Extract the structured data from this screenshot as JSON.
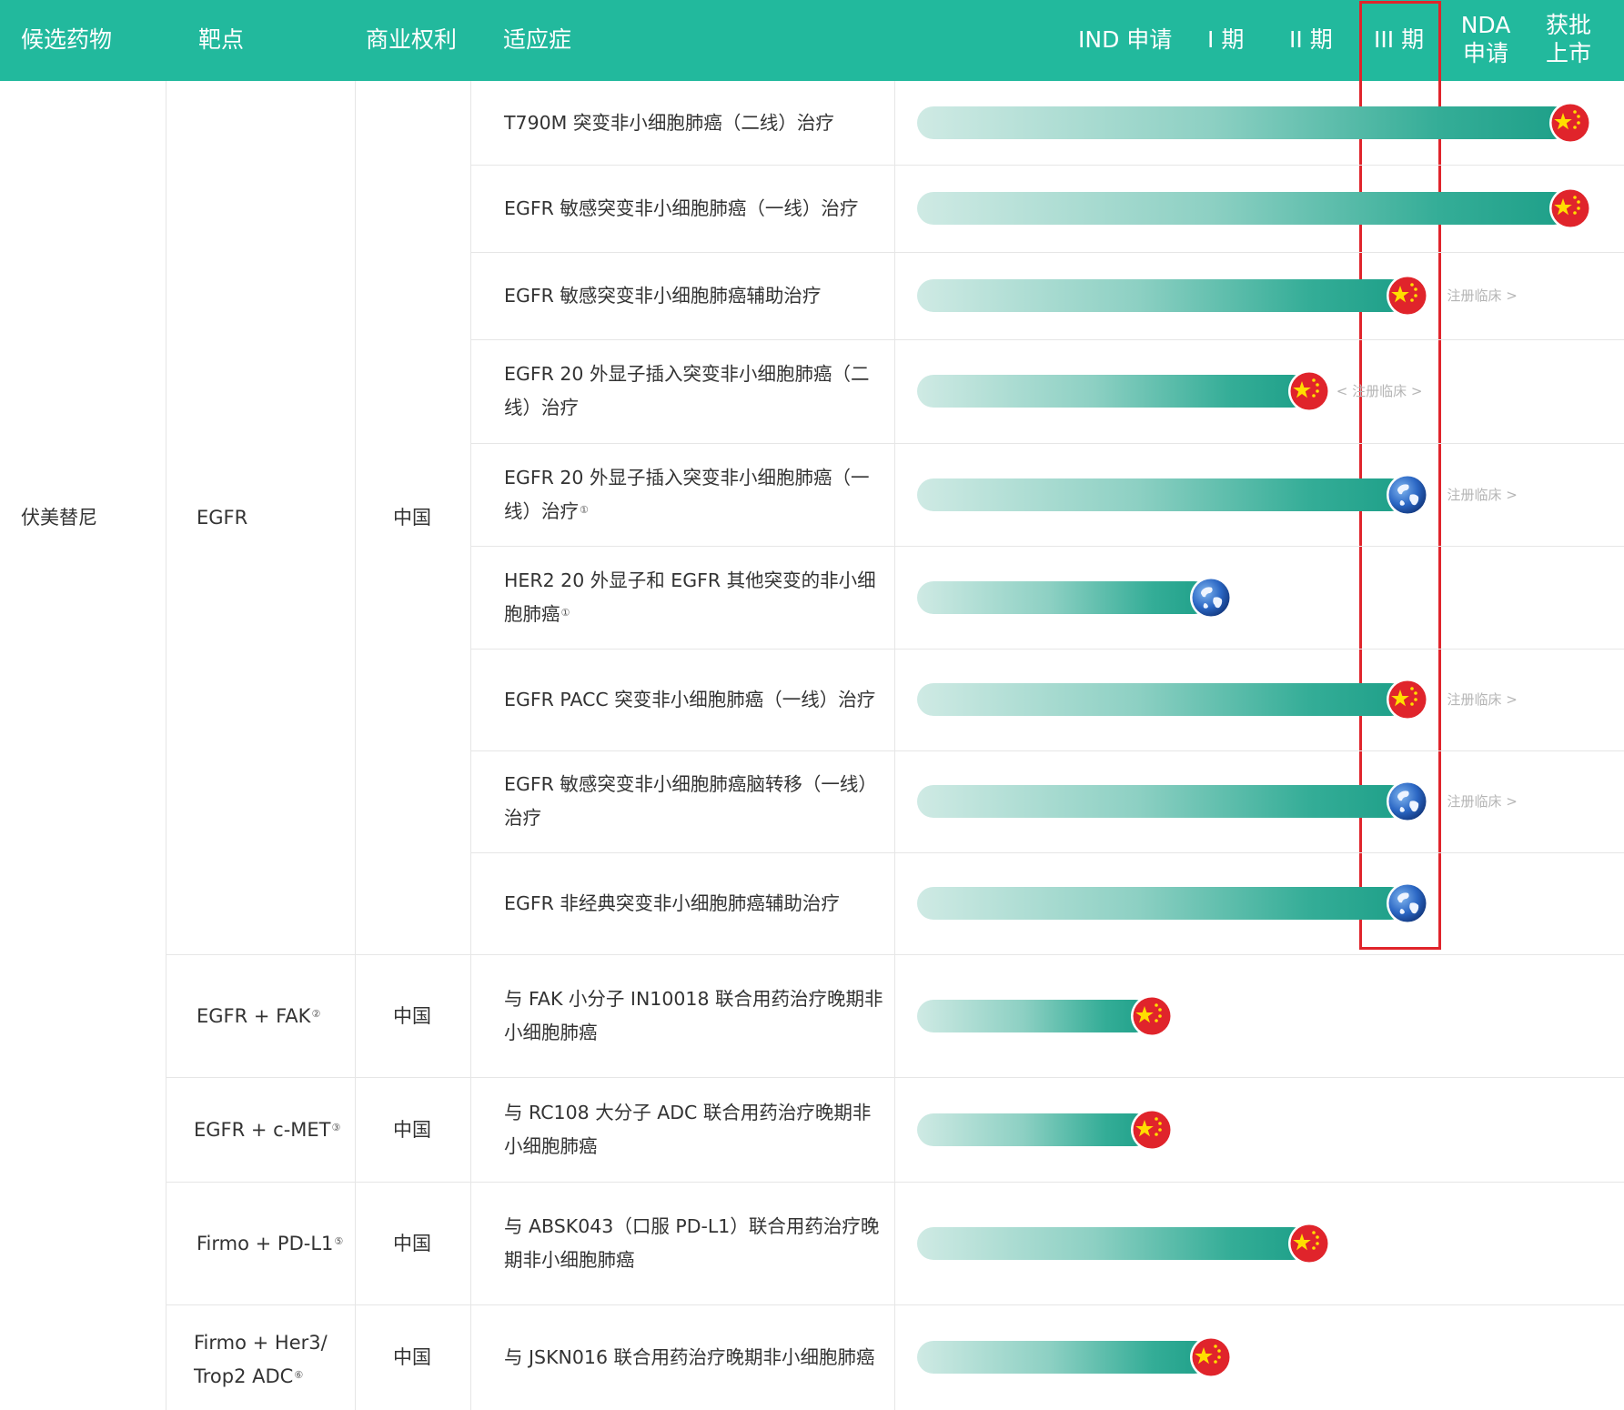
{
  "header": {
    "candidate": "候选药物",
    "target": "靶点",
    "rights": "商业权利",
    "indication": "适应症",
    "stage_ind": "IND 申请",
    "stage_p1": "I 期",
    "stage_p2": "II 期",
    "stage_p3": "III 期",
    "stage_nda_line1": "NDA",
    "stage_nda_line2": "申请",
    "stage_approved_line1": "获批",
    "stage_approved_line2": "上市"
  },
  "colors": {
    "header_bg": "#22b99d",
    "bar_end": "#1d9f88",
    "highlight": "#e0242b"
  },
  "candidate": "伏美替尼",
  "register_label": "注册临床 >",
  "register_label_left": "< 注册临床 >",
  "groups": [
    {
      "target": "EGFR",
      "target_note": "",
      "rights": "中国"
    },
    {
      "target": "EGFR + FAK",
      "target_note": "②",
      "rights": "中国"
    },
    {
      "target": "EGFR + c-MET",
      "target_note": "③",
      "rights": "中国"
    },
    {
      "target": "Firmo + PD-L1",
      "target_note": "⑤",
      "rights": "中国"
    },
    {
      "target_line1": "Firmo + Her3/",
      "target_line2": "Trop2 ADC",
      "target_note": "⑥",
      "rights": "中国"
    }
  ],
  "rows": [
    {
      "indication": "T790M 突变非小细胞肺癌（二线）治疗",
      "note": "",
      "progress": 1.0,
      "icon": "china-flag-icon",
      "label": ""
    },
    {
      "indication": "EGFR 敏感突变非小细胞肺癌（一线）治疗",
      "note": "",
      "progress": 1.0,
      "icon": "china-flag-icon",
      "label": ""
    },
    {
      "indication": "EGFR 敏感突变非小细胞肺癌辅助治疗",
      "note": "",
      "progress": 0.75,
      "icon": "china-flag-icon",
      "label": "注册临床 >"
    },
    {
      "indication": "EGFR 20 外显子插入突变非小细胞肺癌（二线）治疗",
      "note": "",
      "progress": 0.6,
      "icon": "china-flag-icon",
      "label": "< 注册临床 >"
    },
    {
      "indication": "EGFR 20 外显子插入突变非小细胞肺癌（一线）治疗",
      "note": "①",
      "progress": 0.75,
      "icon": "globe-icon",
      "label": "注册临床 >"
    },
    {
      "indication": "HER2 20 外显子和 EGFR 其他突变的非小细胞肺癌",
      "note": "①",
      "progress": 0.45,
      "icon": "globe-icon",
      "label": ""
    },
    {
      "indication": "EGFR PACC 突变非小细胞肺癌（一线）治疗",
      "note": "",
      "progress": 0.75,
      "icon": "china-flag-icon",
      "label": "注册临床 >"
    },
    {
      "indication": "EGFR 敏感突变非小细胞肺癌脑转移（一线）治疗",
      "note": "",
      "progress": 0.75,
      "icon": "globe-icon",
      "label": "注册临床 >"
    },
    {
      "indication": "EGFR 非经典突变非小细胞肺癌辅助治疗",
      "note": "",
      "progress": 0.75,
      "icon": "globe-icon",
      "label": ""
    },
    {
      "indication": "与 FAK 小分子 IN10018 联合用药治疗晚期非小细胞肺癌",
      "note": "",
      "progress": 0.36,
      "icon": "china-flag-icon",
      "label": ""
    },
    {
      "indication": "与 RC108 大分子 ADC 联合用药治疗晚期非小细胞肺癌",
      "note": "",
      "progress": 0.36,
      "icon": "china-flag-icon",
      "label": ""
    },
    {
      "indication": "与 ABSK043（口服 PD-L1）联合用药治疗晚期非小细胞肺癌",
      "note": "",
      "progress": 0.6,
      "icon": "china-flag-icon",
      "label": ""
    },
    {
      "indication": "与 JSKN016 联合用药治疗晚期非小细胞肺癌",
      "note": "",
      "progress": 0.45,
      "icon": "china-flag-icon",
      "label": ""
    }
  ]
}
